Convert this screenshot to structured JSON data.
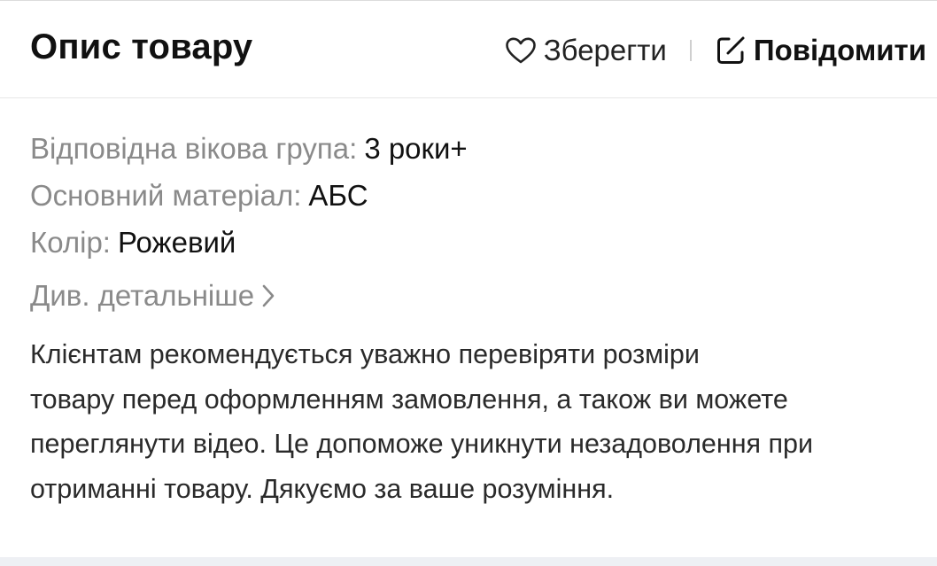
{
  "header": {
    "title": "Опис товару",
    "save_label": "Зберегти",
    "report_label": "Повідомити",
    "icons": {
      "save": "heart-icon",
      "report": "edit-report-icon"
    }
  },
  "attributes": [
    {
      "label": "Відповідна вікова група:",
      "value": "3 роки+"
    },
    {
      "label": "Основний матеріал:",
      "value": "АБС"
    },
    {
      "label": "Колір:",
      "value": "Рожевий"
    }
  ],
  "more_link": {
    "label": "Див. детальніше",
    "icon": "chevron-right-icon"
  },
  "description": {
    "lines": [
      "Клієнтам рекомендується уважно перевіряти розміри",
      "товару перед оформленням замовлення, а також ви можете",
      "переглянути відео. Це допоможе уникнути незадоволення при",
      "отриманні товару. Дякуємо за ваше розуміння."
    ]
  },
  "colors": {
    "label_gray": "#8a8a8a",
    "text_dark": "#111111",
    "divider": "#e6e6e6"
  }
}
